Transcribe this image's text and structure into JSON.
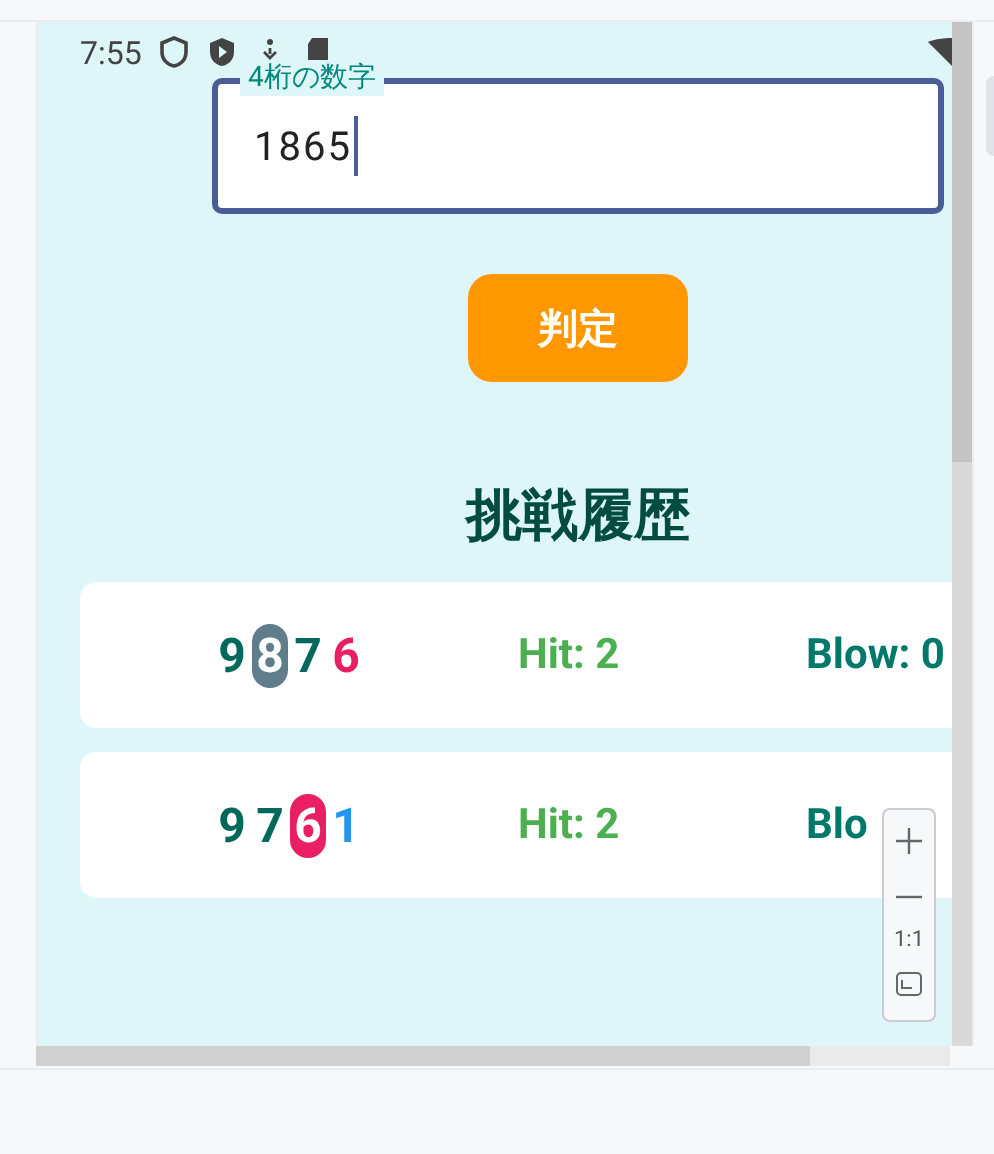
{
  "status_bar": {
    "time": "7:55"
  },
  "input": {
    "label": "4桁の数字",
    "value": "1865"
  },
  "judge_button": {
    "label": "判定"
  },
  "history": {
    "title": "挑戦履歴",
    "rows": [
      {
        "digits": [
          {
            "text": "9",
            "kind": "plain",
            "color": "#00695c"
          },
          {
            "text": "8",
            "kind": "pill",
            "color": "#607d8b"
          },
          {
            "text": "7",
            "kind": "plain",
            "color": "#00695c"
          },
          {
            "text": "6",
            "kind": "plain",
            "color": "#e91e63"
          }
        ],
        "hit": "Hit: 2",
        "blow": "Blow: 0"
      },
      {
        "digits": [
          {
            "text": "9",
            "kind": "plain",
            "color": "#00695c"
          },
          {
            "text": "7",
            "kind": "plain",
            "color": "#00695c"
          },
          {
            "text": "6",
            "kind": "pill",
            "color": "#e91e63"
          },
          {
            "text": "1",
            "kind": "plain",
            "color": "#2196f3"
          }
        ],
        "hit": "Hit: 2",
        "blow": "Blo"
      }
    ]
  },
  "zoom_controls": {
    "reset": "1:1"
  }
}
